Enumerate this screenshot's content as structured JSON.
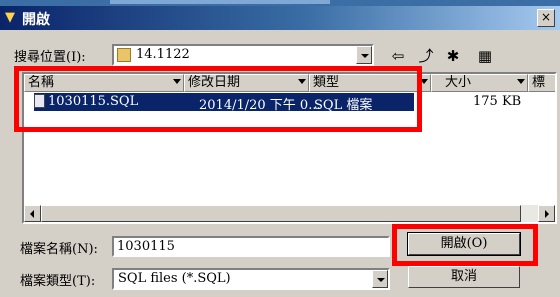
{
  "window": {
    "title": "開啟",
    "close_label": "×"
  },
  "lookin": {
    "label": "搜尋位置(I):",
    "value": "14.1122"
  },
  "toolbar": {
    "back_glyph": "⇦",
    "up_glyph": "⤴",
    "newfolder_glyph": "✱",
    "views_glyph": "▦"
  },
  "columns": {
    "name": "名稱",
    "date": "修改日期",
    "type": "類型",
    "size": "大小",
    "tags": "標"
  },
  "files": [
    {
      "name": "1030115.SQL",
      "date": "2014/1/20 下午 0...",
      "type": "SQL 檔案",
      "size": "175 KB"
    }
  ],
  "filename": {
    "label": "檔案名稱(N):",
    "value": "1030115"
  },
  "filetype": {
    "label": "檔案類型(T):",
    "value": "SQL files (*.SQL)"
  },
  "buttons": {
    "open": "開啟(O)",
    "cancel": "取消"
  },
  "colors": {
    "highlight": "#ff0000",
    "selection": "#0a246a",
    "face": "#d4d0c8"
  }
}
